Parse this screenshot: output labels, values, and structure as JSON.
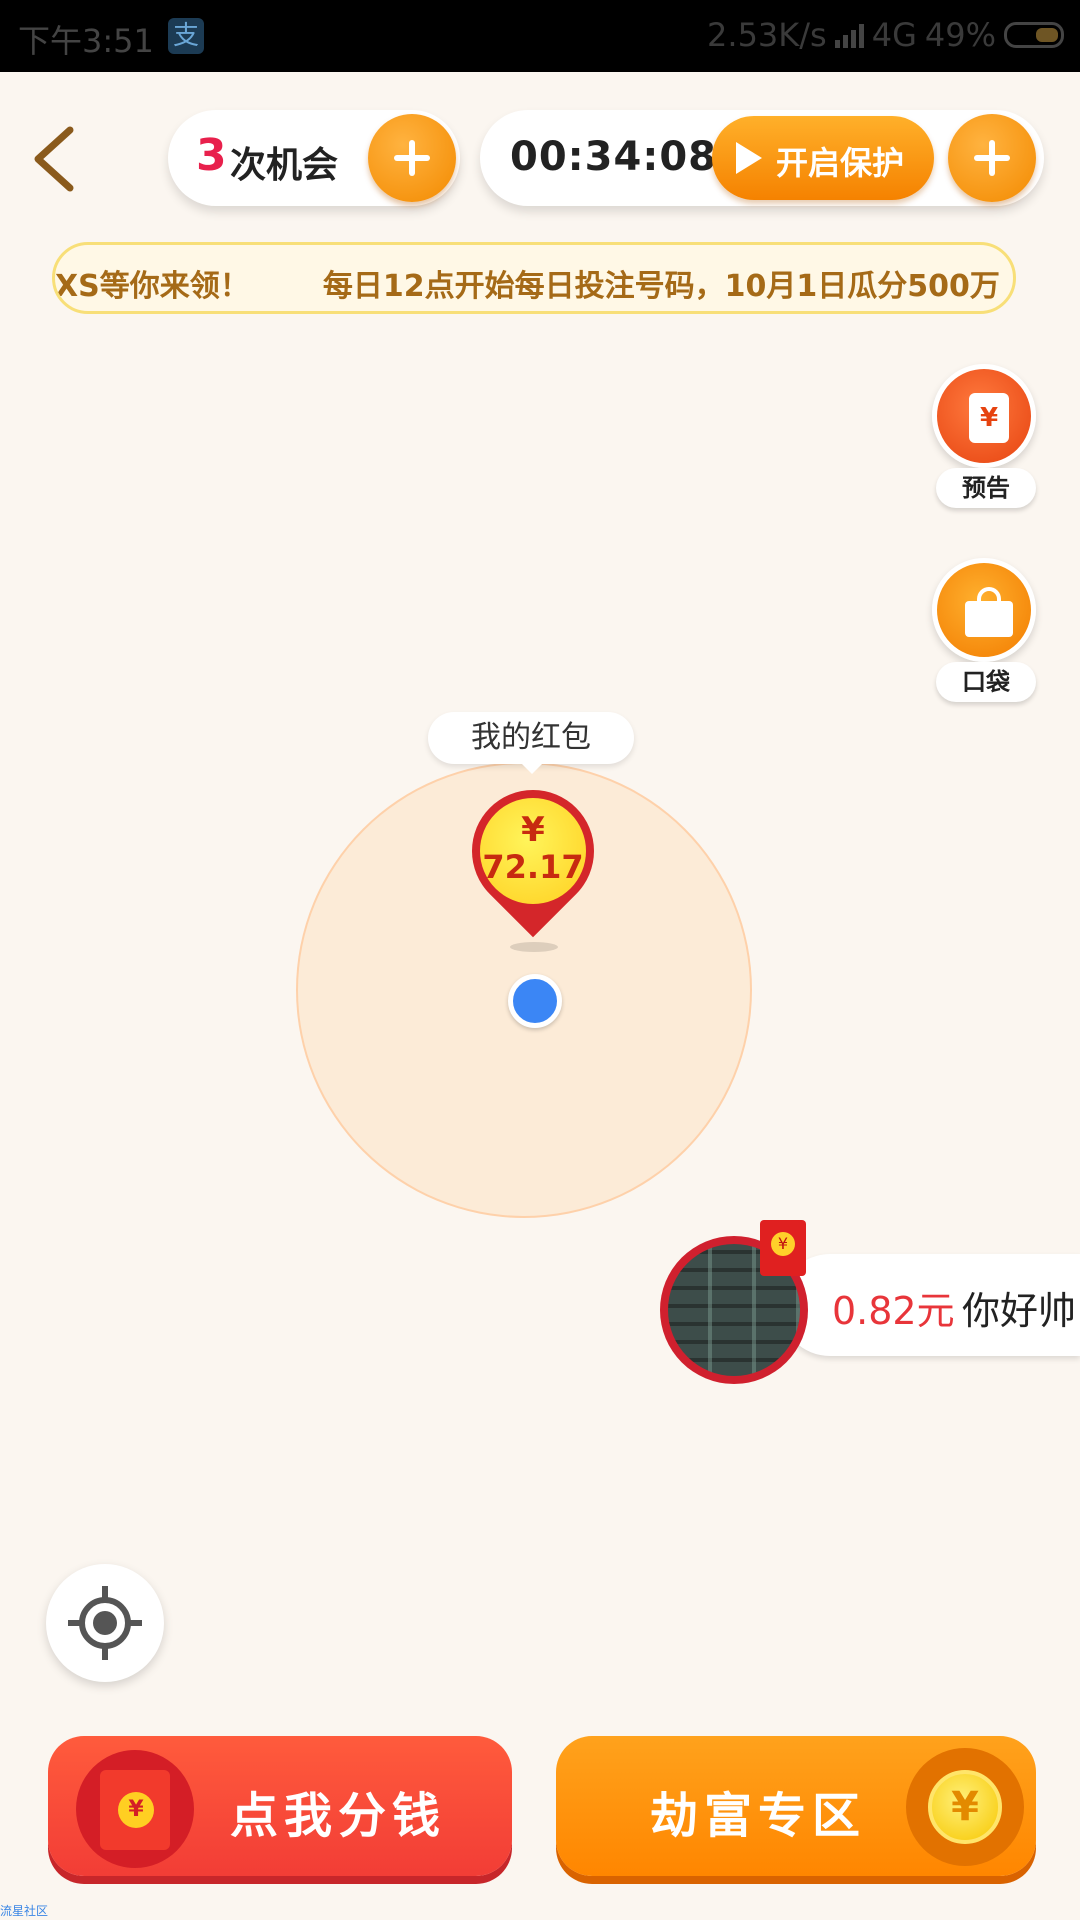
{
  "status_bar": {
    "time": "下午3:51",
    "app_icon": "alipay-icon",
    "net_speed": "2.53K/s",
    "network": "4G",
    "battery": "49%"
  },
  "header": {
    "chances_count": "3",
    "chances_label": "次机会",
    "timer": "00:34:08",
    "protect_label": "开启保护"
  },
  "banner": {
    "text": "XS等你来领！       每日12点开始每日投注号码，10月1日瓜分500万"
  },
  "side_buttons": {
    "notice_label": "预告",
    "notice_icon_glyph": "¥",
    "pocket_label": "口袋"
  },
  "map": {
    "my_packet_label": "我的红包",
    "pin_symbol": "¥",
    "pin_amount": "72.17"
  },
  "nearby_user": {
    "amount": "0.82元",
    "name": "你好帅"
  },
  "bottom": {
    "share_label": "点我分钱",
    "share_coin": "¥",
    "rob_label": "劫富专区",
    "rob_coin": "¥"
  },
  "watermark": "流星社区",
  "colors": {
    "accent_orange": "#f38a00",
    "accent_red": "#f23d36",
    "background": "#fbf6f0",
    "location_blue": "#3b86f5"
  }
}
